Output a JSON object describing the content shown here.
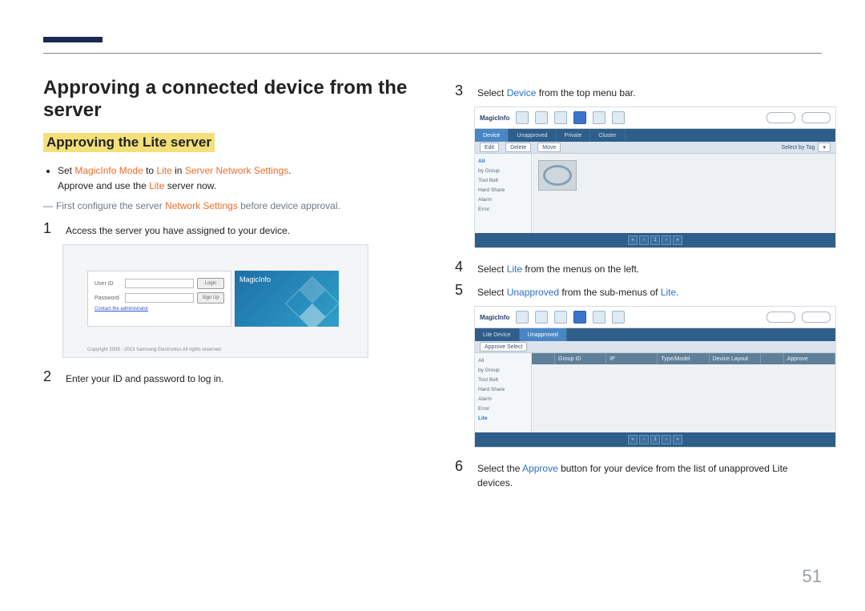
{
  "page_number": "51",
  "heading": "Approving a connected device from the server",
  "subheading": "Approving the Lite server",
  "bullet": {
    "pre": "Set ",
    "k1": "MagicInfo Mode",
    "mid1": " to ",
    "k2": "Lite",
    "mid2": " in ",
    "k3": "Server Network Settings",
    "post": ".",
    "line2a": "Approve and use the ",
    "line2k": "Lite",
    "line2b": " server now."
  },
  "note": {
    "pre": "First configure the server ",
    "k": "Network Settings",
    "post": " before device approval."
  },
  "steps": {
    "s1": {
      "n": "1",
      "t": "Access the server you have assigned to your device."
    },
    "s2": {
      "n": "2",
      "t": "Enter your ID and password to log in."
    },
    "s3": {
      "n": "3",
      "pre": "Select ",
      "k": "Device",
      "post": " from the top menu bar."
    },
    "s4": {
      "n": "4",
      "pre": "Select ",
      "k": "Lite",
      "post": " from the menus on the left."
    },
    "s5": {
      "n": "5",
      "pre": "Select ",
      "k": "Unapproved",
      "post": " from the sub-menus of ",
      "k2": "Lite",
      "post2": "."
    },
    "s6": {
      "n": "6",
      "pre": "Select the ",
      "k": "Approve",
      "post": " button for your device from the list of unapproved Lite devices."
    }
  },
  "login": {
    "user": "User ID",
    "pass": "Password",
    "login": "Login",
    "signup": "Sign Up",
    "contact": "Contact the administrator",
    "brand": "MagicInfo",
    "copyright": "Copyright 2009 - 2013 Samsung Electronics All rights reserved"
  },
  "admin": {
    "logo": "MagicInfo",
    "tabs": [
      "Device",
      "Unapproved",
      "Private",
      "Cluster"
    ],
    "sub_btns": [
      "Edit",
      "Delete",
      "Move"
    ],
    "sub_right": "Select by Tag",
    "side1": [
      "All",
      "by Group",
      "Tool Belt",
      "Hard Share",
      "Alarm",
      "Error"
    ],
    "lite_tabs": [
      "Lite Device",
      "Unapproved"
    ],
    "lite_action": "Approve Select",
    "side2": [
      "All",
      "by Group",
      "Tool Belt",
      "Hard Share",
      "Alarm",
      "Error",
      "Lite"
    ],
    "cols": [
      "",
      "Group ID",
      "IP",
      "Type/Model",
      "Device Layout",
      "",
      "Approve"
    ]
  }
}
